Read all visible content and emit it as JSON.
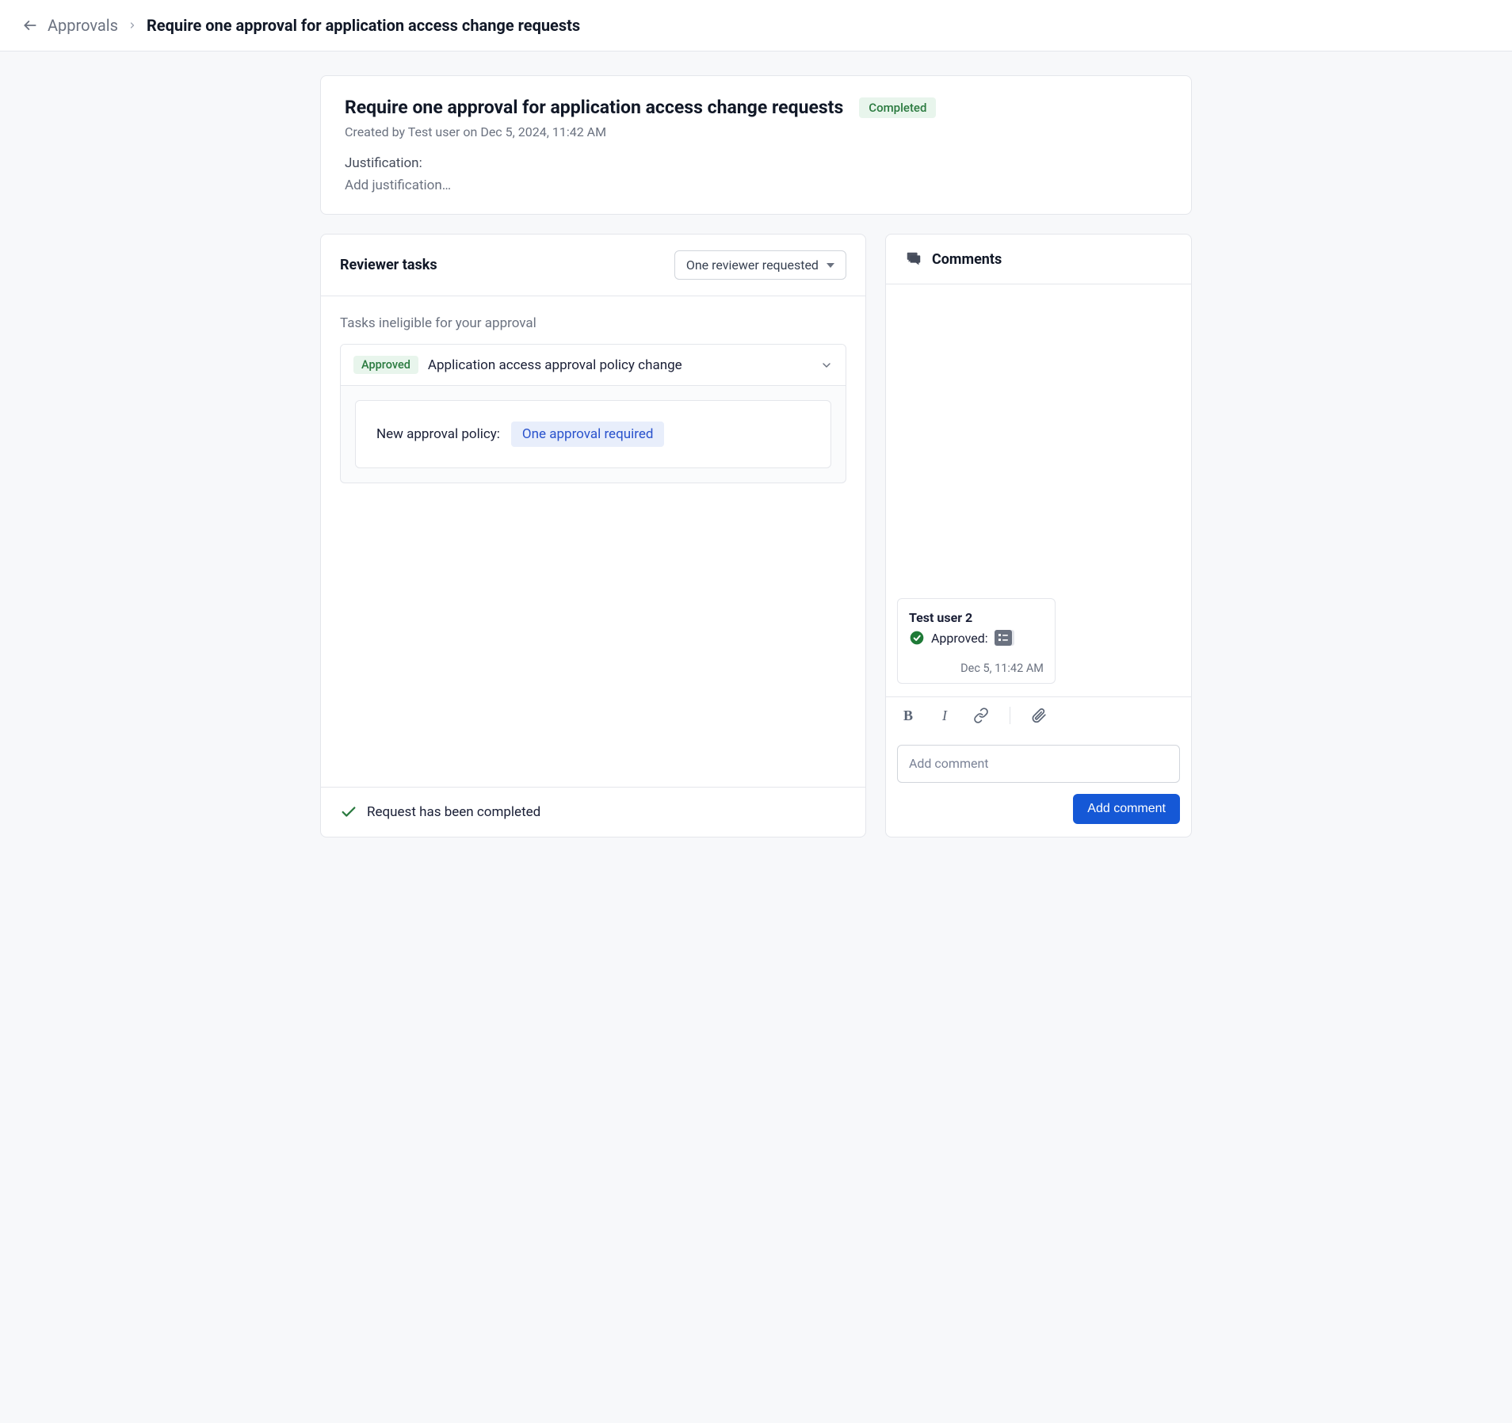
{
  "breadcrumb": {
    "parent": "Approvals",
    "title": "Require one approval for application access change requests"
  },
  "summary": {
    "title": "Require one approval for application access change requests",
    "status": "Completed",
    "created_by": "Created by Test user on Dec 5, 2024, 11:42 AM",
    "justification_label": "Justification:",
    "justification_placeholder": "Add justification…"
  },
  "reviewer": {
    "header": "Reviewer tasks",
    "select_value": "One reviewer requested",
    "ineligible_label": "Tasks ineligible for your approval",
    "task": {
      "status": "Approved",
      "title": "Application access approval policy change",
      "policy_label": "New approval policy:",
      "policy_value": "One approval required"
    },
    "footer": "Request has been completed"
  },
  "comments": {
    "header": "Comments",
    "items": [
      {
        "author": "Test user 2",
        "status_text": "Approved:",
        "timestamp": "Dec 5, 11:42 AM"
      }
    ],
    "input_placeholder": "Add comment",
    "submit_label": "Add comment"
  }
}
